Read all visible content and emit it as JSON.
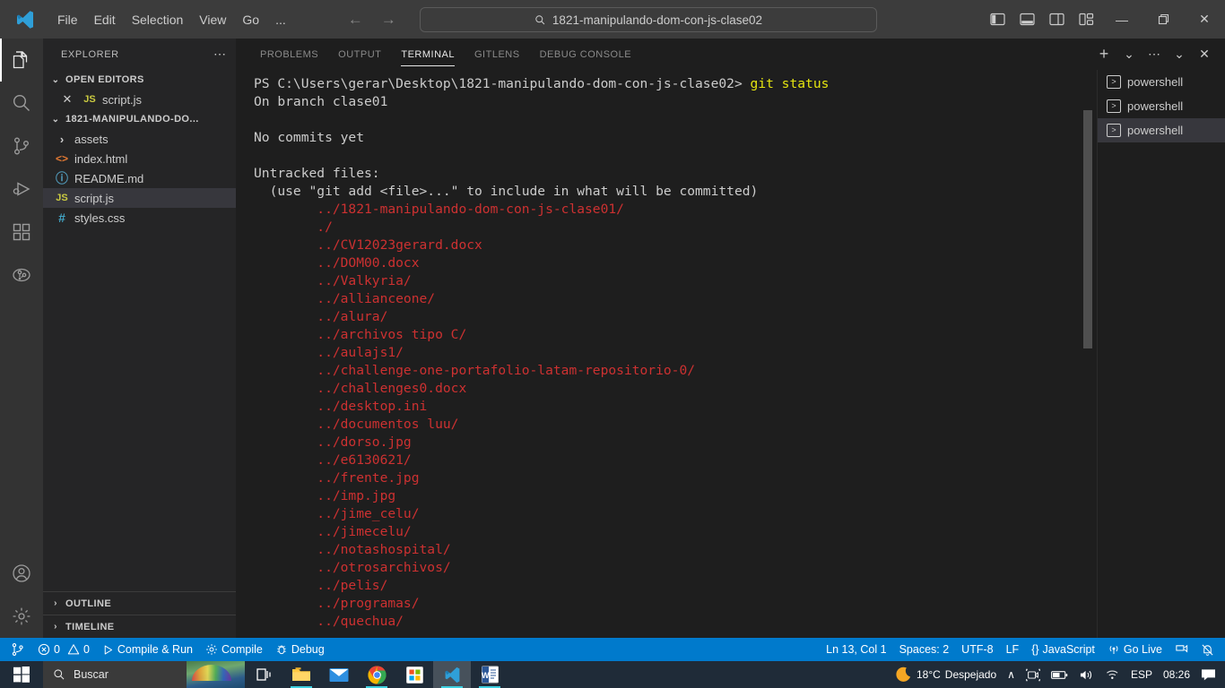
{
  "titlebar": {
    "menu": [
      "File",
      "Edit",
      "Selection",
      "View",
      "Go",
      "..."
    ],
    "back_arrow": "←",
    "forward_arrow": "→",
    "command_center_text": "1821-manipulando-dom-con-js-clase02",
    "minimize": "—",
    "maximize": "❐",
    "close": "✕"
  },
  "activitybar": {
    "items": [
      {
        "name": "explorer",
        "active": true
      },
      {
        "name": "search",
        "active": false
      },
      {
        "name": "source-control",
        "active": false
      },
      {
        "name": "run-and-debug",
        "active": false
      },
      {
        "name": "extensions",
        "active": false
      },
      {
        "name": "gitlens",
        "active": false
      }
    ],
    "bottom": [
      {
        "name": "accounts"
      },
      {
        "name": "manage-settings"
      }
    ]
  },
  "sidebar": {
    "title": "EXPLORER",
    "more_actions": "⋯",
    "open_editors": {
      "label": "OPEN EDITORS",
      "twisty": "⌄",
      "items": [
        {
          "close": "✕",
          "icon": "JS",
          "label": "script.js"
        }
      ]
    },
    "project": {
      "label": "1821-MANIPULANDO-DO...",
      "twisty": "⌄",
      "files": [
        {
          "kind": "folder",
          "icon": "›",
          "label": "assets",
          "selected": false
        },
        {
          "kind": "html",
          "icon": "<>",
          "label": "index.html",
          "selected": false
        },
        {
          "kind": "md",
          "icon": "ⓘ",
          "label": "README.md",
          "selected": false
        },
        {
          "kind": "js",
          "icon": "JS",
          "label": "script.js",
          "selected": true
        },
        {
          "kind": "css",
          "icon": "#",
          "label": "styles.css",
          "selected": false
        }
      ]
    },
    "bottom_sections": [
      {
        "label": "OUTLINE",
        "twisty": "›"
      },
      {
        "label": "TIMELINE",
        "twisty": "›"
      }
    ]
  },
  "panel": {
    "tabs": [
      {
        "label": "PROBLEMS",
        "active": false
      },
      {
        "label": "OUTPUT",
        "active": false
      },
      {
        "label": "TERMINAL",
        "active": true
      },
      {
        "label": "GITLENS",
        "active": false
      },
      {
        "label": "DEBUG CONSOLE",
        "active": false
      }
    ],
    "actions": {
      "new_terminal": "+",
      "new_terminal_dropdown": "⌄",
      "views_and_more": "⋯",
      "hide_panel": "⌄",
      "close_panel": "✕"
    },
    "terminal_tabs": [
      {
        "label": "powershell",
        "active": false
      },
      {
        "label": "powershell",
        "active": false
      },
      {
        "label": "powershell",
        "active": true
      }
    ],
    "terminal": {
      "prompt": "PS C:\\Users\\gerar\\Desktop\\1821-manipulando-dom-con-js-clase02> ",
      "command": "git status",
      "branch_line": "On branch clase01",
      "no_commits_line": "No commits yet",
      "untracked_header": "Untracked files:",
      "untracked_hint": "  (use \"git add <file>...\" to include in what will be committed)",
      "untracked_files": [
        "../1821-manipulando-dom-con-js-clase01/",
        "./",
        "../CV12023gerard.docx",
        "../DOM00.docx",
        "../Valkyria/",
        "../allianceone/",
        "../alura/",
        "../archivos tipo C/",
        "../aulajs1/",
        "../challenge-one-portafolio-latam-repositorio-0/",
        "../challenges0.docx",
        "../desktop.ini",
        "../documentos luu/",
        "../dorso.jpg",
        "../e6130621/",
        "../frente.jpg",
        "../imp.jpg",
        "../jime_celu/",
        "../jimecelu/",
        "../notashospital/",
        "../otrosarchivos/",
        "../pelis/",
        "../programas/",
        "../quechua/"
      ]
    }
  },
  "statusbar": {
    "left": [
      {
        "name": "remote-indicator",
        "label": ""
      },
      {
        "name": "problems",
        "label": "0",
        "label2": "0"
      },
      {
        "name": "compile-and-run",
        "label": "Compile & Run"
      },
      {
        "name": "compile",
        "label": "Compile"
      },
      {
        "name": "debug",
        "label": "Debug"
      }
    ],
    "right": [
      {
        "name": "editor-position",
        "label": "Ln 13, Col 1"
      },
      {
        "name": "indentation",
        "label": "Spaces: 2"
      },
      {
        "name": "encoding",
        "label": "UTF-8"
      },
      {
        "name": "eol",
        "label": "LF"
      },
      {
        "name": "language-mode",
        "label": "JavaScript",
        "prefix": "{}"
      },
      {
        "name": "go-live",
        "label": "Go Live"
      }
    ]
  },
  "taskbar": {
    "search_placeholder": "Buscar",
    "apps": [
      {
        "name": "task-view",
        "running": false
      },
      {
        "name": "file-explorer",
        "running": true
      },
      {
        "name": "mail",
        "running": false
      },
      {
        "name": "chrome",
        "running": true
      },
      {
        "name": "microsoft-store",
        "running": false
      },
      {
        "name": "vscode",
        "running": true,
        "active": true
      },
      {
        "name": "word",
        "running": true
      }
    ],
    "tray": {
      "weather_temp": "18°C",
      "weather_desc": "Despejado",
      "show_hidden": "∧",
      "language": "ESP",
      "clock": "08:26"
    }
  }
}
